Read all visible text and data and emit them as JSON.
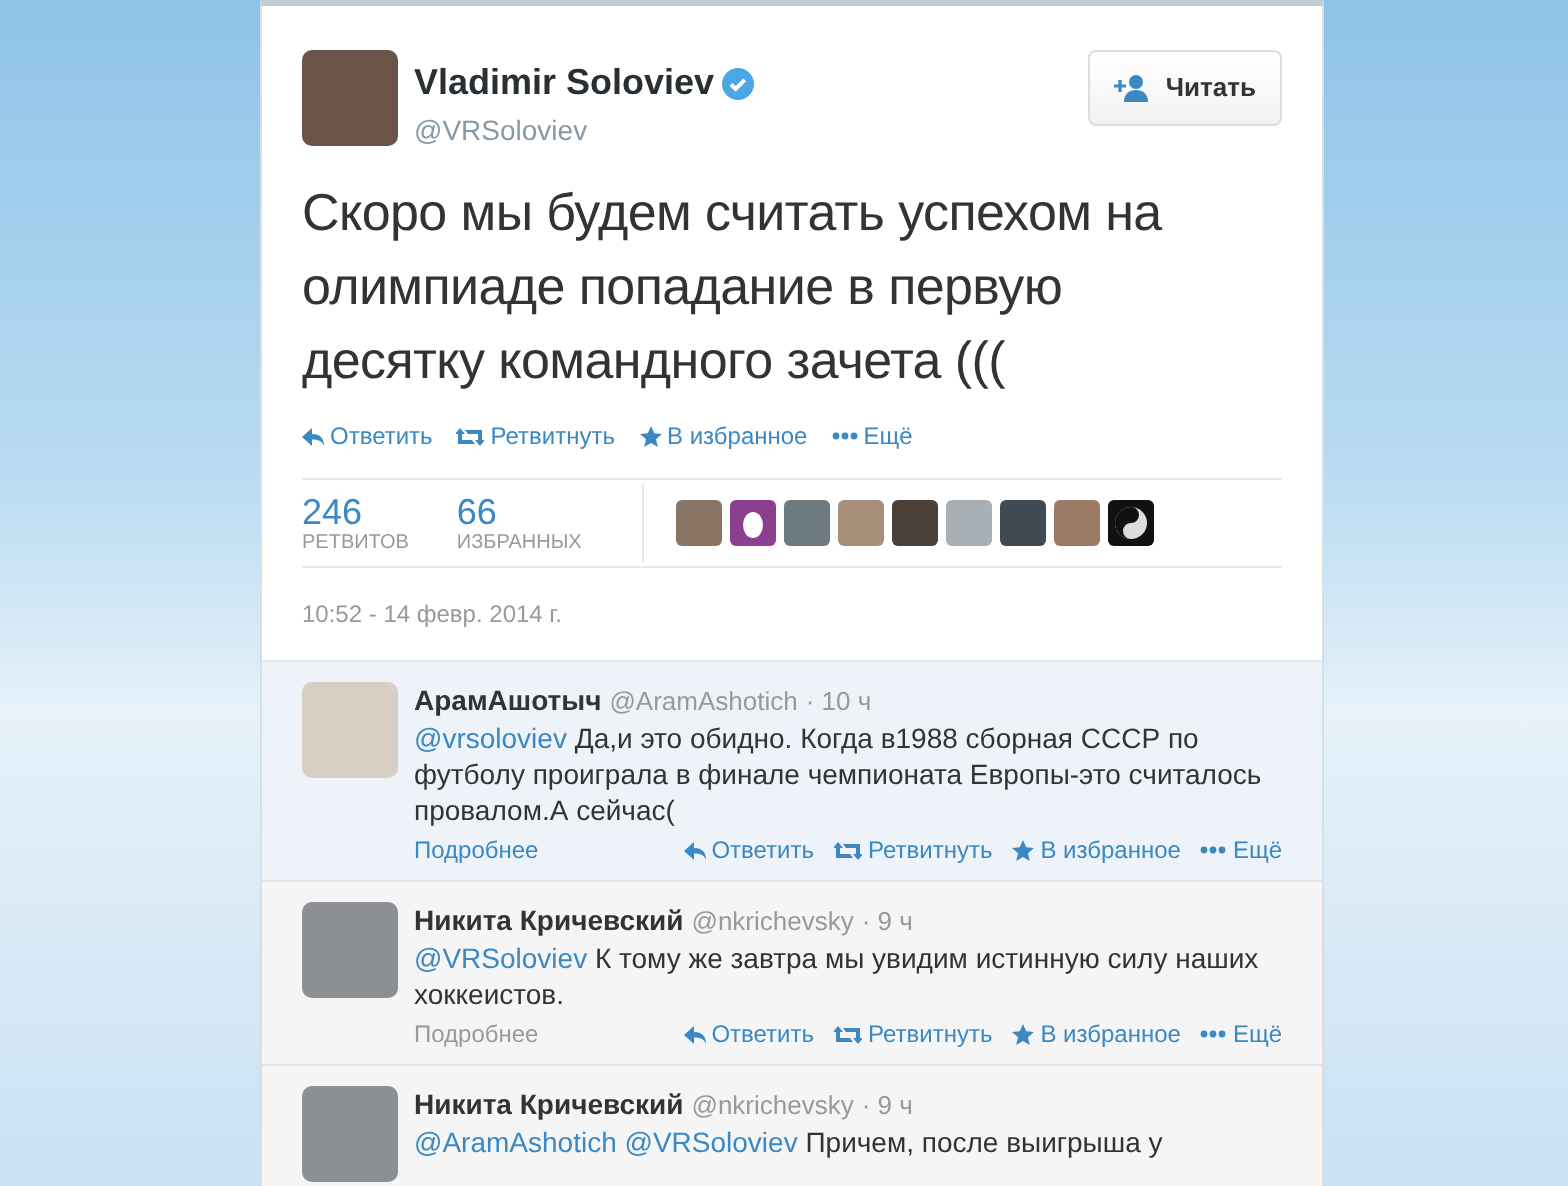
{
  "tweet": {
    "author": {
      "name": "Vladimir Soloviev",
      "handle": "@VRSoloviev",
      "verified": true
    },
    "follow_button": "Читать",
    "text": "Скоро мы будем считать успехом на олимпиаде попадание в первую десятку командного зачета (((",
    "actions": [
      {
        "kind": "reply",
        "label": "Ответить"
      },
      {
        "kind": "retweet",
        "label": "Ретвитнуть"
      },
      {
        "kind": "favorite",
        "label": "В избранное"
      },
      {
        "kind": "more",
        "label": "Ещё"
      }
    ],
    "stats": [
      {
        "value": "246",
        "label": "РЕТВИТОВ"
      },
      {
        "value": "66",
        "label": "ИЗБРАННЫХ"
      }
    ],
    "favoriters": [
      {
        "kind": "photo"
      },
      {
        "kind": "egg"
      },
      {
        "kind": "photo"
      },
      {
        "kind": "photo"
      },
      {
        "kind": "photo"
      },
      {
        "kind": "photo"
      },
      {
        "kind": "photo"
      },
      {
        "kind": "photo"
      },
      {
        "kind": "symbol"
      }
    ],
    "timestamp": "10:52 - 14 февр. 2014 г."
  },
  "replies": [
    {
      "name": "АрамАшотыч",
      "handle": "@AramAshotich",
      "time": "· 10 ч",
      "mentions": [
        "@vrsoloviev"
      ],
      "text": "Да,и это обидно. Когда в1988 сборная СССР по футболу проиграла в финале чемпионата Европы-это считалось провалом.А сейчас(",
      "details": "Подробнее",
      "highlighted": true,
      "actions": [
        {
          "kind": "reply",
          "label": "Ответить"
        },
        {
          "kind": "retweet",
          "label": "Ретвитнуть"
        },
        {
          "kind": "favorite",
          "label": "В избранное"
        },
        {
          "kind": "more",
          "label": "Ещё"
        }
      ]
    },
    {
      "name": "Никита Кричевский",
      "handle": "@nkrichevsky",
      "time": "· 9 ч",
      "mentions": [
        "@VRSoloviev"
      ],
      "text": "К тому же завтра мы увидим истинную силу наших хоккеистов.",
      "details": "Подробнее",
      "highlighted": false,
      "actions": [
        {
          "kind": "reply",
          "label": "Ответить"
        },
        {
          "kind": "retweet",
          "label": "Ретвитнуть"
        },
        {
          "kind": "favorite",
          "label": "В избранное"
        },
        {
          "kind": "more",
          "label": "Ещё"
        }
      ]
    },
    {
      "name": "Никита Кричевский",
      "handle": "@nkrichevsky",
      "time": "· 9 ч",
      "mentions": [
        "@AramAshotich",
        "@VRSoloviev"
      ],
      "text": "Причем, после выигрыша у"
    }
  ]
}
